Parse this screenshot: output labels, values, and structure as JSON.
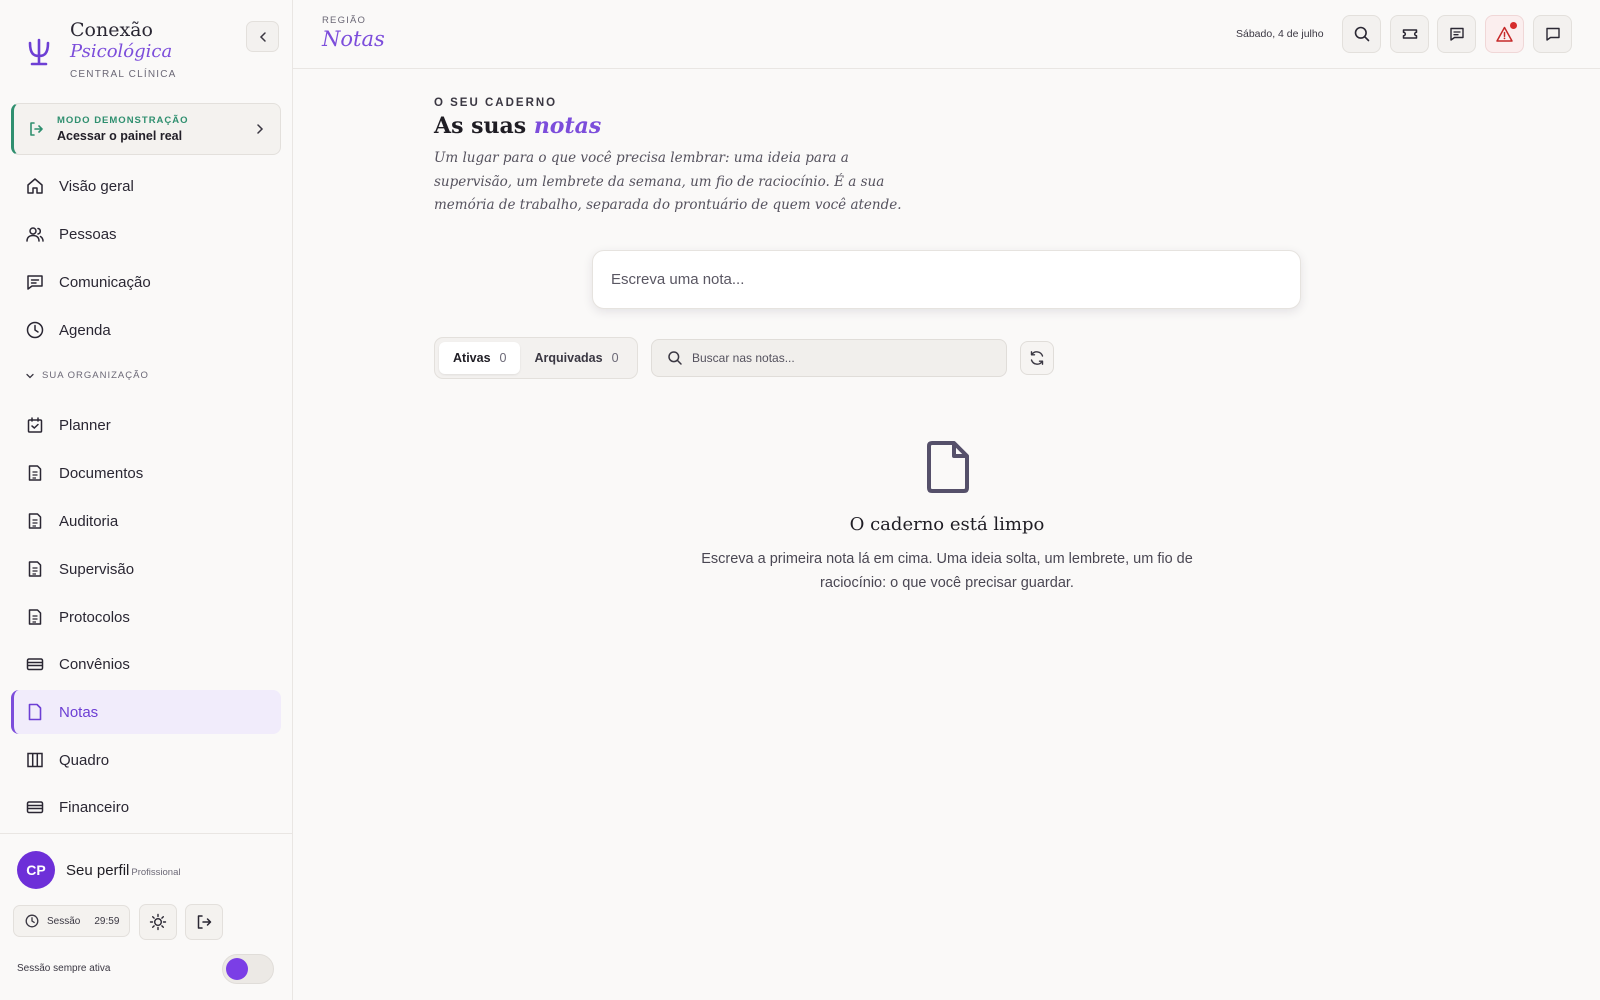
{
  "brand": {
    "name_line1": "Conexão",
    "name_line2": "Psicológica",
    "subtitle": "CENTRAL CLÍNICA"
  },
  "demo": {
    "kicker": "MODO DEMONSTRAÇÃO",
    "title": "Acessar o painel real"
  },
  "nav_primary": [
    {
      "label": "Visão geral",
      "icon": "home-icon"
    },
    {
      "label": "Pessoas",
      "icon": "users-icon"
    },
    {
      "label": "Comunicação",
      "icon": "message-icon"
    },
    {
      "label": "Agenda",
      "icon": "clock-icon"
    }
  ],
  "org_section_label": "SUA ORGANIZAÇÃO",
  "nav_org": [
    {
      "label": "Planner",
      "icon": "calendar-check-icon"
    },
    {
      "label": "Documentos",
      "icon": "document-icon"
    },
    {
      "label": "Auditoria",
      "icon": "document-icon"
    },
    {
      "label": "Supervisão",
      "icon": "document-icon"
    },
    {
      "label": "Protocolos",
      "icon": "document-icon"
    },
    {
      "label": "Convênios",
      "icon": "card-icon"
    },
    {
      "label": "Notas",
      "icon": "file-icon",
      "active": true
    },
    {
      "label": "Quadro",
      "icon": "columns-icon"
    },
    {
      "label": "Financeiro",
      "icon": "card-icon"
    }
  ],
  "profile": {
    "initials": "CP",
    "name": "Seu perfil",
    "role": "Profissional"
  },
  "session": {
    "label": "Sessão",
    "time": "29:59",
    "keep_alive_label": "Sessão sempre ativa",
    "keep_alive_on": true
  },
  "topbar": {
    "kicker": "REGIÃO",
    "title": "Notas",
    "date": "Sábado, 4 de julho",
    "buttons": [
      "search-icon",
      "ticket-icon",
      "chat-list-icon",
      "alert-icon",
      "chat-icon"
    ]
  },
  "main": {
    "kicker": "O SEU CADERNO",
    "heading_prefix": "As suas",
    "heading_emphasis": "notas",
    "intro": "Um lugar para o que você precisa lembrar: uma ideia para a supervisão, um lembrete da semana, um fio de raciocínio. É a sua memória de trabalho, separada do prontuário de quem você atende.",
    "composer_placeholder": "Escreva uma nota...",
    "tabs": [
      {
        "label": "Ativas",
        "count": "0",
        "active": true
      },
      {
        "label": "Arquivadas",
        "count": "0",
        "active": false
      }
    ],
    "search_placeholder": "Buscar nas notas...",
    "empty_title": "O caderno está limpo",
    "empty_desc": "Escreva a primeira nota lá em cima. Uma ideia solta, um lembrete, um fio de raciocínio: o que você precisar guardar."
  },
  "colors": {
    "accent": "#7c4ddb",
    "demo_green": "#2f8f6f",
    "alert_red": "#d62c2c",
    "avatar": "#6d2fd8"
  }
}
